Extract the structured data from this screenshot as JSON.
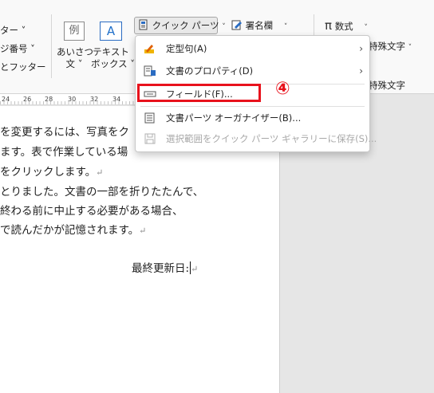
{
  "ribbon": {
    "left_items": [
      "ター ˅",
      "ジ番号 ˅",
      "とフッター"
    ],
    "greeting": {
      "icon_char": "例",
      "label_line1": "あいさつ",
      "label_line2": "文 ˅"
    },
    "textbox": {
      "icon_char": "A",
      "label_line1": "テキスト",
      "label_line2": "ボックス ˅"
    },
    "quick_parts": "クイック パーツ",
    "signature": "署名欄",
    "equation": "数式",
    "symbols_frag": "",
    "special_chars": "特殊文字"
  },
  "ruler": {
    "labels": [
      "24",
      "26",
      "28",
      "30",
      "32",
      "34"
    ]
  },
  "document": {
    "lines": [
      "を変更するには、写真をク",
      "ます。表で作業している場",
      "をクリックします。",
      "とりました。文書の一部を折りたたんで、",
      "終わる前に中止する必要がある場合、",
      "で読んだかが記憶されます。"
    ],
    "last_updated": "最終更新日:",
    "para_mark": "↵"
  },
  "menu": {
    "items": [
      {
        "label": "定型句(A)",
        "submenu": true,
        "disabled": false
      },
      {
        "label": "文書のプロパティ(D)",
        "submenu": true,
        "disabled": false
      },
      {
        "label": "フィールド(F)...",
        "submenu": false,
        "disabled": false
      },
      {
        "label": "文書パーツ オーガナイザー(B)...",
        "submenu": false,
        "disabled": false
      },
      {
        "label": "選択範囲をクイック パーツ ギャラリーに保存(S)...",
        "submenu": false,
        "disabled": true
      }
    ]
  },
  "annotation": {
    "step": "④",
    "color": "#e8121c"
  }
}
